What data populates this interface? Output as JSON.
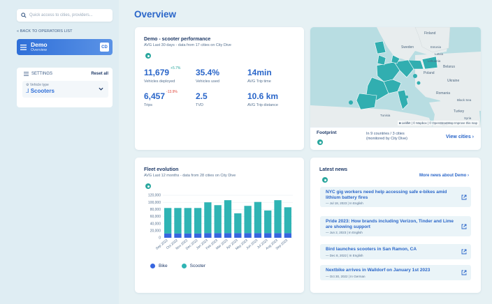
{
  "sidebar": {
    "search_placeholder": "Quick access to cities, providers...",
    "back_label": "« BACK TO OPERATORS LIST",
    "operator": {
      "name": "Demo",
      "subtitle": "Overview",
      "badge": "CD"
    },
    "settings": {
      "label": "SETTINGS",
      "reset": "Reset all",
      "vehicle_type_label": "Vehicle type",
      "vehicle_type_value": "Scooters"
    }
  },
  "page_title": "Overview",
  "performance": {
    "title": "Demo - scooter performance",
    "subtitle": "AVG Last 30 days - data from 17 cities on City Dive",
    "metrics": [
      {
        "value": "11,679",
        "delta": "+5.7%",
        "label": "Vehicles deployed"
      },
      {
        "value": "35.4%",
        "delta": "",
        "label": "Vehicles used"
      },
      {
        "value": "14min",
        "delta": "",
        "label": "AVG Trip time"
      },
      {
        "value": "6,457",
        "delta": "-13.9%",
        "label": "Trips"
      },
      {
        "value": "2.5",
        "delta": "",
        "label": "TVD"
      },
      {
        "value": "10.6 km",
        "delta": "",
        "label": "AVG Trip distance"
      }
    ]
  },
  "map": {
    "labels": [
      "Finland",
      "Sweden",
      "Estonia",
      "Latvia",
      "Lithuania",
      "Belarus",
      "Poland",
      "Ukraine",
      "Romania",
      "Black Sea",
      "Turkey",
      "Syria",
      "Tunisia",
      "Libya",
      "Egypt"
    ],
    "attribution": "■ Leaflet | © Mapbox | © OpenStreetMap  Improve this map",
    "footprint_title": "Footprint",
    "footprint_info_1": "In 9 countries / 3 cities",
    "footprint_info_2": "(monitored by City Dive)",
    "view_cities": "View cities ›",
    "colors": {
      "land": "#e8edee",
      "sea": "#b8dde2",
      "highlight": "#31aeb0"
    }
  },
  "fleet": {
    "title": "Fleet evolution",
    "subtitle": "AVG Last 12 months - data from 28 cities on City Dive"
  },
  "news": {
    "title": "Latest news",
    "more": "More news about Demo ›",
    "items": [
      {
        "title": "NYC gig workers need help accessing safe e-bikes amid lithium battery fires",
        "meta": "— Jul 18, 2023 | In English"
      },
      {
        "title": "Pride 2023: How brands including Verizon, Tinder and Lime are showing support",
        "meta": "— Jun 2, 2023 | In English"
      },
      {
        "title": "Bird launches scooters in San Ramon, CA",
        "meta": "— Dec 8, 2022 | In English"
      },
      {
        "title": "Nextbike arrives in Walldorf on January 1st 2023",
        "meta": "— Oct 30, 2022 | In German"
      }
    ]
  },
  "chart_data": {
    "type": "bar",
    "stacked": true,
    "categories": [
      "Sep 2022",
      "Oct 2022",
      "Nov 2022",
      "Dec 2022",
      "Jan 2023",
      "Feb 2023",
      "Mar 2023",
      "Apr 2023",
      "May 2023",
      "Jun 2023",
      "Jul 2023",
      "Aug 2023",
      "Sep 2023"
    ],
    "series": [
      {
        "name": "Bike",
        "color": "#3766e0",
        "values": [
          12000,
          12000,
          12000,
          12000,
          13000,
          13000,
          13000,
          13000,
          13000,
          13000,
          13000,
          13000,
          13000
        ]
      },
      {
        "name": "Scooter",
        "color": "#2fb4b4",
        "values": [
          72000,
          72000,
          72000,
          72000,
          87000,
          79000,
          93000,
          56000,
          77000,
          88000,
          64000,
          93000,
          73000
        ]
      }
    ],
    "yticks": [
      "0",
      "20,000",
      "40,000",
      "60,000",
      "80,000",
      "100,000",
      "120,000"
    ],
    "ylim": [
      0,
      120000
    ]
  }
}
